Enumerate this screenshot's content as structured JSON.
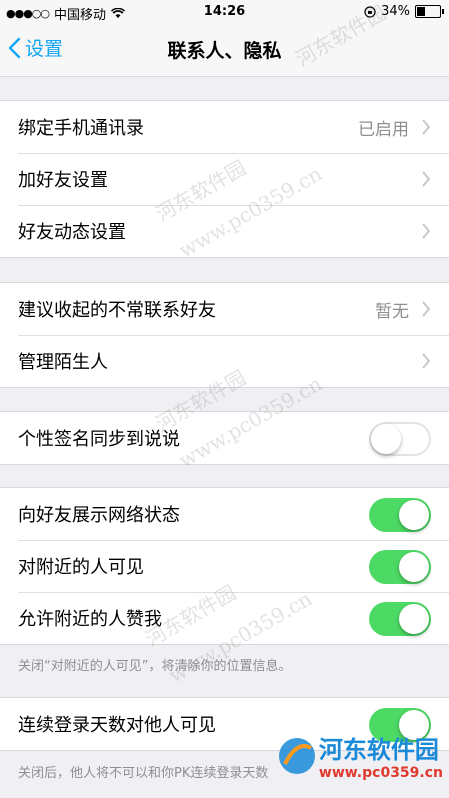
{
  "status_bar": {
    "carrier": "中国移动",
    "time": "14:26",
    "battery": "34%"
  },
  "nav": {
    "back_label": "设置",
    "title": "联系人、隐私"
  },
  "group1": [
    {
      "label": "绑定手机通讯录",
      "value": "已启用"
    },
    {
      "label": "加好友设置"
    },
    {
      "label": "好友动态设置"
    }
  ],
  "group2": [
    {
      "label": "建议收起的不常联系好友",
      "value": "暂无"
    },
    {
      "label": "管理陌生人"
    }
  ],
  "group3": [
    {
      "label": "个性签名同步到说说",
      "toggle": false
    }
  ],
  "group4": [
    {
      "label": "向好友展示网络状态",
      "toggle": true
    },
    {
      "label": "对附近的人可见",
      "toggle": true
    },
    {
      "label": "允许附近的人赞我",
      "toggle": true
    }
  ],
  "group4_note": "关闭“对附近的人可见”，将清除你的位置信息。",
  "group5": [
    {
      "label": "连续登录天数对他人可见",
      "toggle": true
    }
  ],
  "group5_note": "关闭后，他人将不可以和你PK连续登录天数",
  "watermark": {
    "text": "河东软件园",
    "url": "www.pc0359.cn",
    "logo_name": "河东软件园",
    "logo_url": "www.pc0359.cn"
  },
  "colors": {
    "accent": "#12a6f2",
    "toggle_on": "#4cd964",
    "background": "#efeff4"
  }
}
